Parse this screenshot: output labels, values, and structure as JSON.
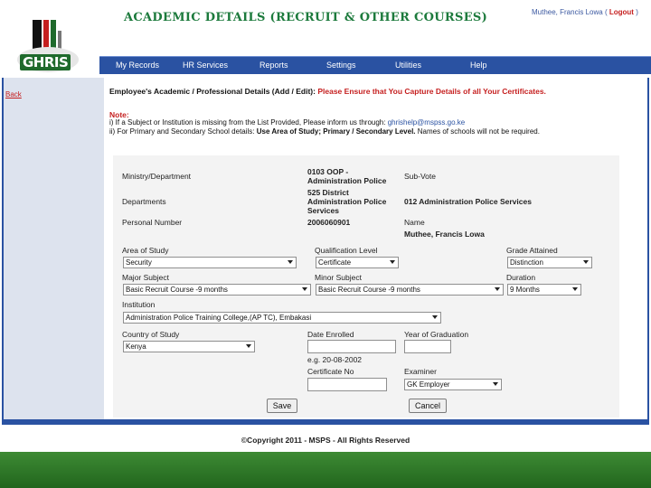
{
  "header": {
    "logo_text": "GHRIS",
    "title": "ACADEMIC DETAILS (RECRUIT & OTHER COURSES)",
    "user_name": "Muthee, Francis Lowa",
    "logout_label": "Logout",
    "logout_open": "(",
    "logout_close": ")"
  },
  "nav": {
    "items": [
      "My Records",
      "HR Services",
      "Reports",
      "Settings",
      "Utilities",
      "Help"
    ]
  },
  "sidebar": {
    "back_label": "Back"
  },
  "form_header": {
    "title": "Employee's Academic /  Professional Details (Add / Edit):",
    "warning": "Please Ensure that You Capture Details of all Your Certificates."
  },
  "note": {
    "title": "Note:",
    "line1_text": "i) If a Subject or Institution is missing from the List Provided, Please inform us through:",
    "line1_email": "ghrishelp@mspss.go.ke",
    "line2_prefix": "ii) For Primary and Secondary School details:",
    "line2_bold": "Use Area of Study; Primary / Secondary Level.",
    "line2_suffix": "Names of schools will not be required."
  },
  "details": {
    "ministry_label": "Ministry/Department",
    "ministry_value_1": "0103 OOP -",
    "ministry_value_2": "Administration Police",
    "subvote_label": "Sub-Vote",
    "department_label": "Departments",
    "department_value_1": "525 District",
    "department_value_2": "Administration Police",
    "department_value_3": "Services",
    "subvote_value": "012 Administration Police Services",
    "personal_number_label": "Personal Number",
    "personal_number_value": "2006060901",
    "name_label": "Name",
    "name_value": "Muthee, Francis Lowa"
  },
  "fields": {
    "area_of_study_label": "Area of Study",
    "area_of_study_value": "Security",
    "qualification_label": "Qualification Level",
    "qualification_value": "Certificate",
    "grade_label": "Grade Attained",
    "grade_value": "Distinction",
    "major_subject_label": "Major Subject",
    "major_subject_value": "Basic Recruit Course -9 months",
    "minor_subject_label": "Minor Subject",
    "minor_subject_value": "Basic Recruit Course -9 months",
    "duration_label": "Duration",
    "duration_value": "9 Months",
    "institution_label": "Institution",
    "institution_value": "Administration Police Training College,(AP TC), Embakasi",
    "country_label": "Country of Study",
    "country_value": "Kenya",
    "date_enrolled_label": "Date Enrolled",
    "date_hint": "e.g. 20-08-2002",
    "year_grad_label": "Year of Graduation",
    "certificate_label": "Certificate No",
    "examiner_label": "Examiner",
    "examiner_value": "GK Employer"
  },
  "buttons": {
    "save": "Save",
    "cancel": "Cancel"
  },
  "footer": {
    "copyright": "©Copyright 2011 - MSPS - All Rights Reserved"
  },
  "colors": {
    "nav_blue": "#2a52a2",
    "title_green": "#1c7a3c",
    "warning_red": "#c51f1f",
    "footer_green": "#2f7a28"
  }
}
